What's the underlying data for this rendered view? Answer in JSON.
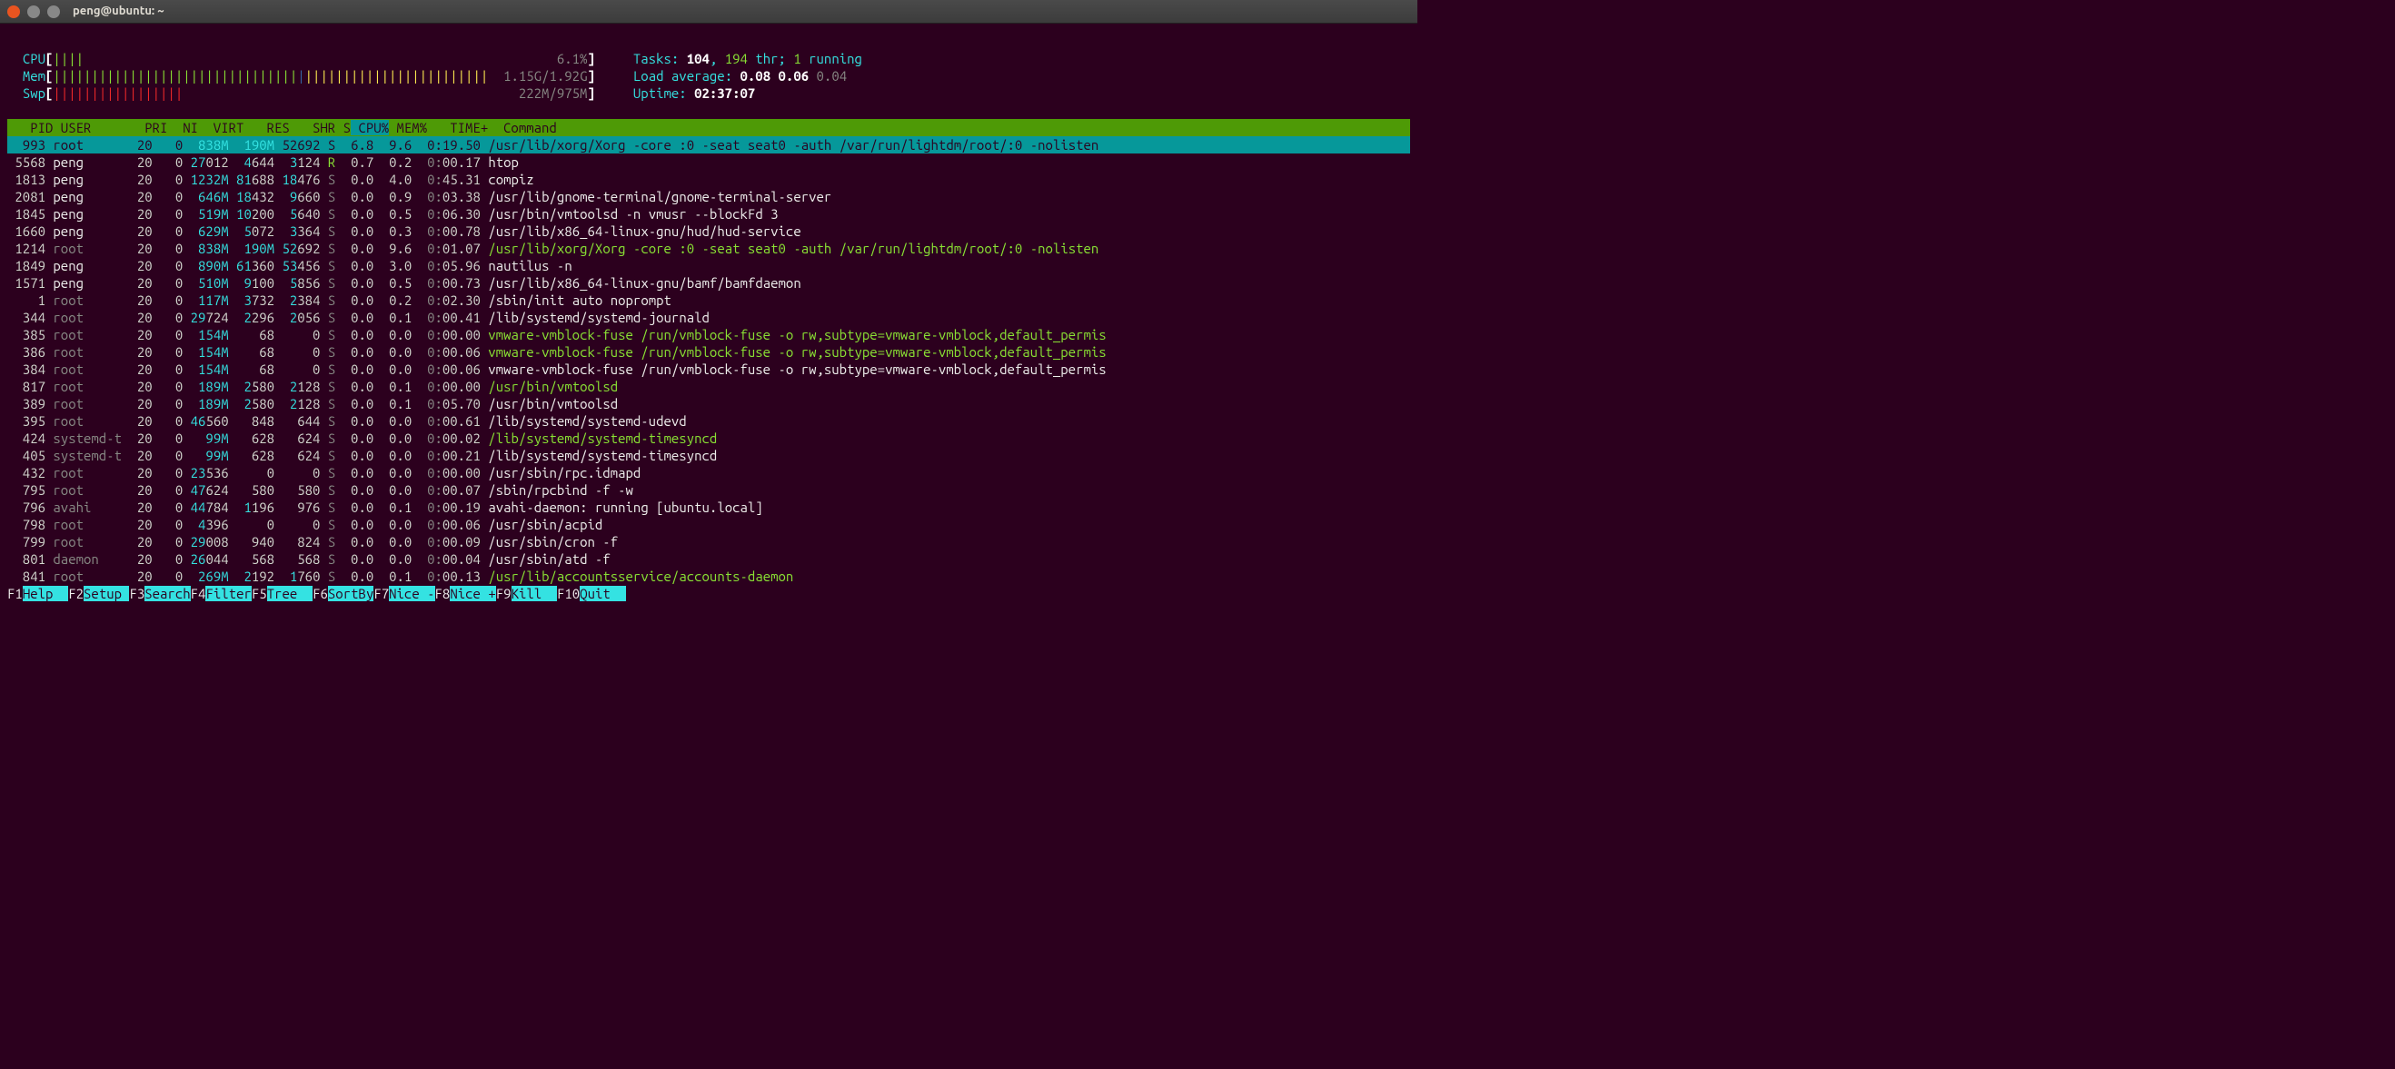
{
  "window": {
    "title": "peng@ubuntu: ~"
  },
  "meters": {
    "cpu": {
      "label": "CPU",
      "bars_g": "||||",
      "pct": "6.1%"
    },
    "mem": {
      "label": "Mem",
      "bars_g": "||||||||||||||||||||||||||||||||",
      "bars_b": "|",
      "bars_y": "||||||||||||||||||||||||",
      "text": "1.15G/1.92G"
    },
    "swp": {
      "label": "Swp",
      "bars_r": "|||||||||||||||||",
      "text": "222M/975M"
    }
  },
  "stats": {
    "tasks_lbl": "Tasks: ",
    "tasks": "104",
    "comma1": ", ",
    "thr": "194",
    "thr_lbl": " thr; ",
    "running": "1",
    "running_lbl": " running",
    "la_lbl": "Load average: ",
    "la1": "0.08",
    "la2": "0.06",
    "la3": "0.04",
    "uptime_lbl": "Uptime: ",
    "uptime": "02:37:07"
  },
  "columns": [
    "  PID",
    "USER     ",
    "PRI",
    " NI",
    " VIRT",
    "  RES",
    "  SHR",
    "S",
    "CPU%",
    "MEM%",
    "  TIME+ ",
    "Command"
  ],
  "sort_col_index": 8,
  "processes": [
    {
      "pid": "993",
      "user": "root",
      "pri": "20",
      "ni": "0",
      "virt": "838M",
      "res": "190M",
      "shr": "52692",
      "s": "S",
      "cpu": "6.8",
      "mem": "9.6",
      "time": "0:19.50",
      "cmd": "/usr/lib/xorg/Xorg -core :0 -seat seat0 -auth /var/run/lightdm/root/:0 -nolisten",
      "u_grey": true,
      "cmd_style": "white",
      "cursor": true
    },
    {
      "pid": "5568",
      "user": "peng",
      "pri": "20",
      "ni": "0",
      "virt": "27012",
      "virt_hl": 2,
      "res": "4644",
      "res_hl": 1,
      "shr": "3124",
      "shr_hl": 1,
      "s": "R",
      "s_g": true,
      "cpu": "0.7",
      "mem": "0.2",
      "time": "0:00.17",
      "cmd": "htop",
      "cmd_style": "white"
    },
    {
      "pid": "1813",
      "user": "peng",
      "pri": "20",
      "ni": "0",
      "virt": "1232M",
      "res": "81688",
      "res_hl": 2,
      "shr": "18476",
      "shr_hl": 2,
      "s": "S",
      "cpu": "0.0",
      "mem": "4.0",
      "time": "0:45.31",
      "cmd": "compiz",
      "cmd_style": "white"
    },
    {
      "pid": "2081",
      "user": "peng",
      "pri": "20",
      "ni": "0",
      "virt": "646M",
      "res": "18432",
      "res_hl": 2,
      "shr": "9660",
      "shr_hl": 1,
      "s": "S",
      "cpu": "0.0",
      "mem": "0.9",
      "time": "0:03.38",
      "cmd": "/usr/lib/gnome-terminal/gnome-terminal-server",
      "cmd_style": "white"
    },
    {
      "pid": "1845",
      "user": "peng",
      "pri": "20",
      "ni": "0",
      "virt": "519M",
      "res": "10200",
      "res_hl": 2,
      "shr": "5640",
      "shr_hl": 1,
      "s": "S",
      "cpu": "0.0",
      "mem": "0.5",
      "time": "0:06.30",
      "cmd": "/usr/bin/vmtoolsd -n vmusr --blockFd 3",
      "cmd_style": "white"
    },
    {
      "pid": "1660",
      "user": "peng",
      "pri": "20",
      "ni": "0",
      "virt": "629M",
      "res": "5072",
      "res_hl": 1,
      "shr": "3364",
      "shr_hl": 1,
      "s": "S",
      "cpu": "0.0",
      "mem": "0.3",
      "time": "0:00.78",
      "cmd": "/usr/lib/x86_64-linux-gnu/hud/hud-service",
      "cmd_style": "white"
    },
    {
      "pid": "1214",
      "user": "root",
      "u_grey": true,
      "pri": "20",
      "ni": "0",
      "virt": "838M",
      "res": "190M",
      "shr": "52692",
      "shr_hl": 2,
      "s": "S",
      "cpu": "0.0",
      "mem": "9.6",
      "time": "0:01.07",
      "cmd": "/usr/lib/xorg/Xorg -core :0 -seat seat0 -auth /var/run/lightdm/root/:0 -nolisten",
      "cmd_style": "green"
    },
    {
      "pid": "1849",
      "user": "peng",
      "pri": "20",
      "ni": "0",
      "virt": "890M",
      "res": "61360",
      "res_hl": 2,
      "shr": "53456",
      "shr_hl": 2,
      "s": "S",
      "cpu": "0.0",
      "mem": "3.0",
      "time": "0:05.96",
      "cmd": "nautilus -n",
      "cmd_style": "white"
    },
    {
      "pid": "1571",
      "user": "peng",
      "pri": "20",
      "ni": "0",
      "virt": "510M",
      "res": "9100",
      "res_hl": 1,
      "shr": "5856",
      "shr_hl": 1,
      "s": "S",
      "cpu": "0.0",
      "mem": "0.5",
      "time": "0:00.73",
      "cmd": "/usr/lib/x86_64-linux-gnu/bamf/bamfdaemon",
      "cmd_style": "white"
    },
    {
      "pid": "1",
      "user": "root",
      "u_grey": true,
      "pri": "20",
      "ni": "0",
      "virt": "117M",
      "res": "3732",
      "res_hl": 1,
      "shr": "2384",
      "shr_hl": 1,
      "s": "S",
      "cpu": "0.0",
      "mem": "0.2",
      "time": "0:02.30",
      "cmd": "/sbin/init auto noprompt",
      "cmd_style": "white"
    },
    {
      "pid": "344",
      "user": "root",
      "u_grey": true,
      "pri": "20",
      "ni": "0",
      "virt": "29724",
      "virt_hl": 2,
      "res": "2296",
      "res_hl": 1,
      "shr": "2056",
      "shr_hl": 1,
      "s": "S",
      "cpu": "0.0",
      "mem": "0.1",
      "time": "0:00.41",
      "cmd": "/lib/systemd/systemd-journald",
      "cmd_style": "white"
    },
    {
      "pid": "385",
      "user": "root",
      "u_grey": true,
      "pri": "20",
      "ni": "0",
      "virt": "154M",
      "res": "68",
      "shr": "0",
      "s": "S",
      "cpu": "0.0",
      "mem": "0.0",
      "time": "0:00.00",
      "cmd": "vmware-vmblock-fuse /run/vmblock-fuse -o rw,subtype=vmware-vmblock,default_permis",
      "cmd_style": "green"
    },
    {
      "pid": "386",
      "user": "root",
      "u_grey": true,
      "pri": "20",
      "ni": "0",
      "virt": "154M",
      "res": "68",
      "shr": "0",
      "s": "S",
      "cpu": "0.0",
      "mem": "0.0",
      "time": "0:00.06",
      "cmd": "vmware-vmblock-fuse /run/vmblock-fuse -o rw,subtype=vmware-vmblock,default_permis",
      "cmd_style": "green"
    },
    {
      "pid": "384",
      "user": "root",
      "u_grey": true,
      "pri": "20",
      "ni": "0",
      "virt": "154M",
      "res": "68",
      "shr": "0",
      "s": "S",
      "cpu": "0.0",
      "mem": "0.0",
      "time": "0:00.06",
      "cmd": "vmware-vmblock-fuse /run/vmblock-fuse -o rw,subtype=vmware-vmblock,default_permis",
      "cmd_style": "white"
    },
    {
      "pid": "817",
      "user": "root",
      "u_grey": true,
      "pri": "20",
      "ni": "0",
      "virt": "189M",
      "res": "2580",
      "res_hl": 1,
      "shr": "2128",
      "shr_hl": 1,
      "s": "S",
      "cpu": "0.0",
      "mem": "0.1",
      "time": "0:00.00",
      "cmd": "/usr/bin/vmtoolsd",
      "cmd_style": "green"
    },
    {
      "pid": "389",
      "user": "root",
      "u_grey": true,
      "pri": "20",
      "ni": "0",
      "virt": "189M",
      "res": "2580",
      "res_hl": 1,
      "shr": "2128",
      "shr_hl": 1,
      "s": "S",
      "cpu": "0.0",
      "mem": "0.1",
      "time": "0:05.70",
      "cmd": "/usr/bin/vmtoolsd",
      "cmd_style": "white"
    },
    {
      "pid": "395",
      "user": "root",
      "u_grey": true,
      "pri": "20",
      "ni": "0",
      "virt": "46560",
      "virt_hl": 2,
      "res": "848",
      "shr": "644",
      "s": "S",
      "cpu": "0.0",
      "mem": "0.0",
      "time": "0:00.61",
      "cmd": "/lib/systemd/systemd-udevd",
      "cmd_style": "white"
    },
    {
      "pid": "424",
      "user": "systemd-t",
      "u_grey": true,
      "pri": "20",
      "ni": "0",
      "virt": "99M",
      "res": "628",
      "shr": "624",
      "s": "S",
      "cpu": "0.0",
      "mem": "0.0",
      "time": "0:00.02",
      "cmd": "/lib/systemd/systemd-timesyncd",
      "cmd_style": "green"
    },
    {
      "pid": "405",
      "user": "systemd-t",
      "u_grey": true,
      "pri": "20",
      "ni": "0",
      "virt": "99M",
      "res": "628",
      "shr": "624",
      "s": "S",
      "cpu": "0.0",
      "mem": "0.0",
      "time": "0:00.21",
      "cmd": "/lib/systemd/systemd-timesyncd",
      "cmd_style": "white"
    },
    {
      "pid": "432",
      "user": "root",
      "u_grey": true,
      "pri": "20",
      "ni": "0",
      "virt": "23536",
      "virt_hl": 2,
      "res": "0",
      "shr": "0",
      "s": "S",
      "cpu": "0.0",
      "mem": "0.0",
      "time": "0:00.00",
      "cmd": "/usr/sbin/rpc.idmapd",
      "cmd_style": "white"
    },
    {
      "pid": "795",
      "user": "root",
      "u_grey": true,
      "pri": "20",
      "ni": "0",
      "virt": "47624",
      "virt_hl": 2,
      "res": "580",
      "shr": "580",
      "s": "S",
      "cpu": "0.0",
      "mem": "0.0",
      "time": "0:00.07",
      "cmd": "/sbin/rpcbind -f -w",
      "cmd_style": "white"
    },
    {
      "pid": "796",
      "user": "avahi",
      "u_grey": true,
      "pri": "20",
      "ni": "0",
      "virt": "44784",
      "virt_hl": 2,
      "res": "1196",
      "res_hl": 1,
      "shr": "976",
      "s": "S",
      "cpu": "0.0",
      "mem": "0.1",
      "time": "0:00.19",
      "cmd": "avahi-daemon: running [ubuntu.local]",
      "cmd_style": "white"
    },
    {
      "pid": "798",
      "user": "root",
      "u_grey": true,
      "pri": "20",
      "ni": "0",
      "virt": "4396",
      "virt_hl": 1,
      "res": "0",
      "shr": "0",
      "s": "S",
      "cpu": "0.0",
      "mem": "0.0",
      "time": "0:00.06",
      "cmd": "/usr/sbin/acpid",
      "cmd_style": "white"
    },
    {
      "pid": "799",
      "user": "root",
      "u_grey": true,
      "pri": "20",
      "ni": "0",
      "virt": "29008",
      "virt_hl": 2,
      "res": "940",
      "shr": "824",
      "s": "S",
      "cpu": "0.0",
      "mem": "0.0",
      "time": "0:00.09",
      "cmd": "/usr/sbin/cron -f",
      "cmd_style": "white"
    },
    {
      "pid": "801",
      "user": "daemon",
      "u_grey": true,
      "pri": "20",
      "ni": "0",
      "virt": "26044",
      "virt_hl": 2,
      "res": "568",
      "shr": "568",
      "s": "S",
      "cpu": "0.0",
      "mem": "0.0",
      "time": "0:00.04",
      "cmd": "/usr/sbin/atd -f",
      "cmd_style": "white"
    },
    {
      "pid": "841",
      "user": "root",
      "u_grey": true,
      "pri": "20",
      "ni": "0",
      "virt": "269M",
      "res": "2192",
      "res_hl": 1,
      "shr": "1760",
      "shr_hl": 1,
      "s": "S",
      "cpu": "0.0",
      "mem": "0.1",
      "time": "0:00.13",
      "cmd": "/usr/lib/accountsservice/accounts-daemon",
      "cmd_style": "green"
    }
  ],
  "fkeys": [
    {
      "k": "F1",
      "l": "Help  "
    },
    {
      "k": "F2",
      "l": "Setup "
    },
    {
      "k": "F3",
      "l": "Search"
    },
    {
      "k": "F4",
      "l": "Filter"
    },
    {
      "k": "F5",
      "l": "Tree  "
    },
    {
      "k": "F6",
      "l": "SortBy"
    },
    {
      "k": "F7",
      "l": "Nice -"
    },
    {
      "k": "F8",
      "l": "Nice +"
    },
    {
      "k": "F9",
      "l": "Kill  "
    },
    {
      "k": "F10",
      "l": "Quit  "
    }
  ]
}
